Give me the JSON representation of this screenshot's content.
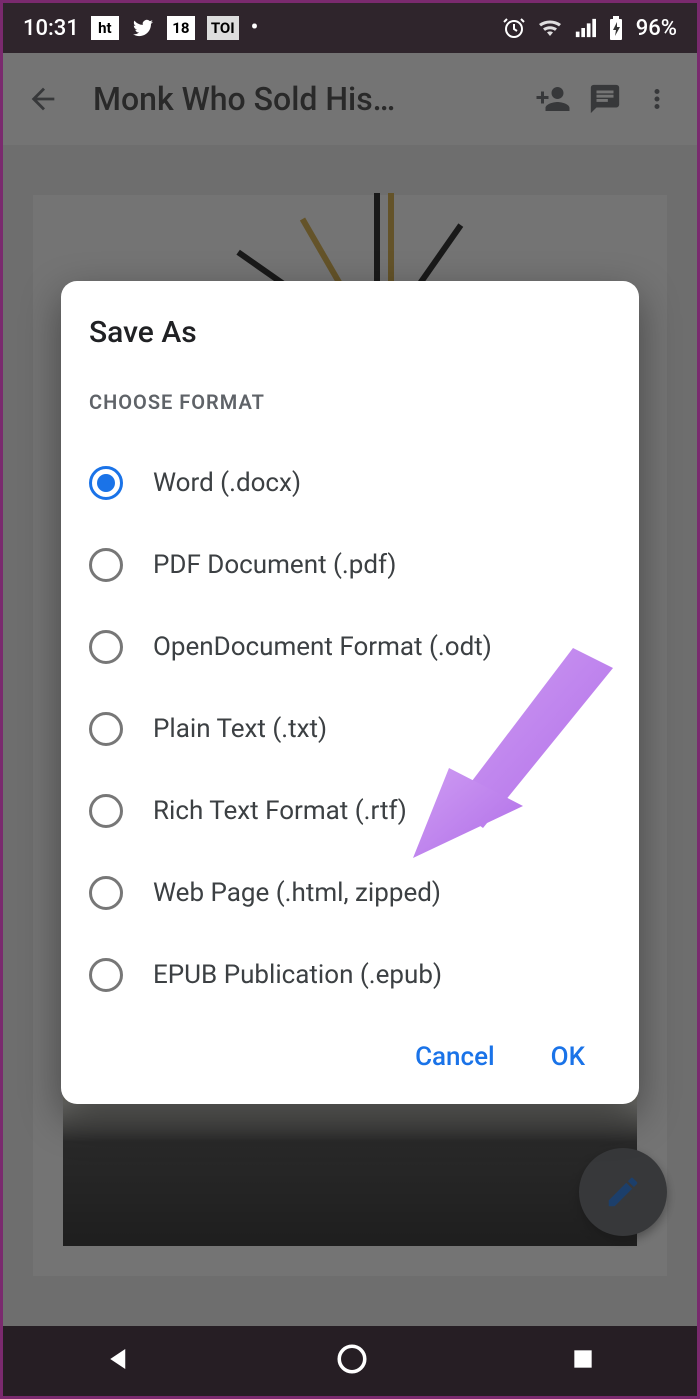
{
  "statusbar": {
    "time": "10:31",
    "notif_chips": [
      "ht",
      "18",
      "TOI"
    ],
    "battery_text": "96%"
  },
  "appbar": {
    "title": "Monk Who Sold His…"
  },
  "dialog": {
    "title": "Save As",
    "subhead": "CHOOSE FORMAT",
    "options": [
      {
        "label": "Word (.docx)",
        "checked": true
      },
      {
        "label": "PDF Document (.pdf)",
        "checked": false
      },
      {
        "label": "OpenDocument Format (.odt)",
        "checked": false
      },
      {
        "label": "Plain Text (.txt)",
        "checked": false
      },
      {
        "label": "Rich Text Format (.rtf)",
        "checked": false
      },
      {
        "label": "Web Page (.html, zipped)",
        "checked": false
      },
      {
        "label": "EPUB Publication (.epub)",
        "checked": false
      }
    ],
    "cancel": "Cancel",
    "ok": "OK"
  },
  "annotation": {
    "color": "#c07df0"
  }
}
